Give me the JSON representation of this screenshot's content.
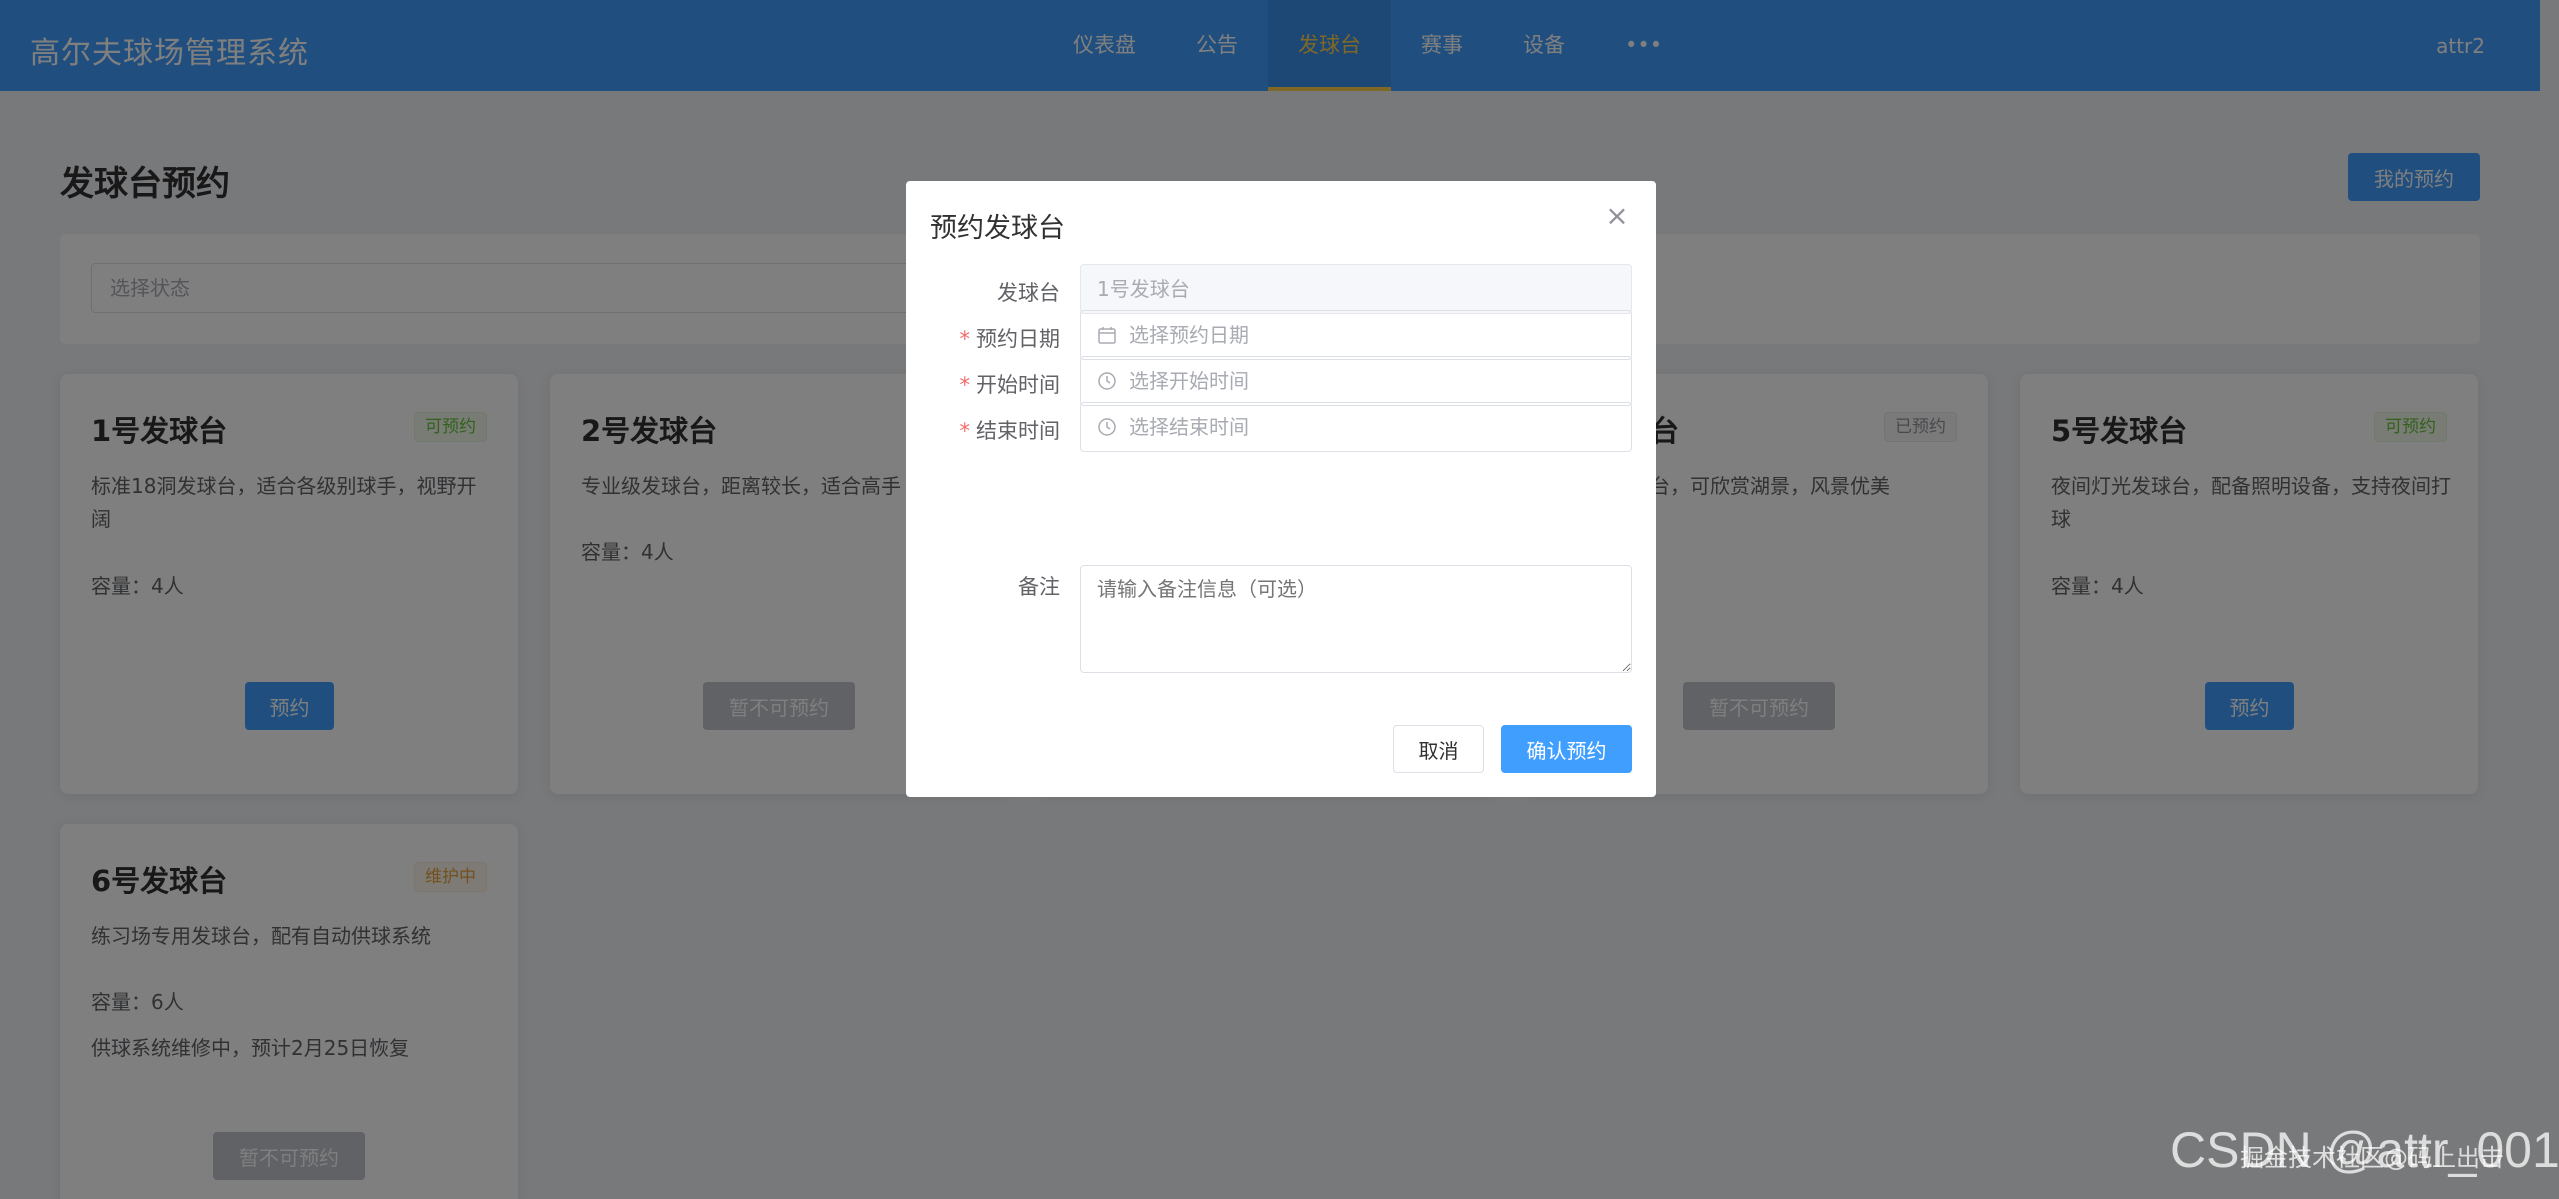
{
  "app": {
    "title": "高尔夫球场管理系统",
    "user": "attr2",
    "nav": [
      "仪表盘",
      "公告",
      "发球台",
      "赛事",
      "设备",
      "•••"
    ]
  },
  "page": {
    "title": "发球台预约",
    "my_bookings": "我的预约",
    "filter_placeholder": "选择状态"
  },
  "tees": [
    {
      "name": "1号发球台",
      "status": "可预约",
      "desc": "标准18洞发球台，适合各级别球手，视野开阔",
      "capacity": "容量：4人",
      "button": "预约"
    },
    {
      "name": "2号发球台",
      "status": "",
      "desc": "专业级发球台，距离较长，适合高手",
      "capacity": "容量：4人",
      "button": "暂不可预约"
    },
    {
      "name": "台",
      "status": "已预约",
      "desc": "台，可欣赏湖景，风景优美",
      "capacity": "",
      "button": "暂不可预约"
    },
    {
      "name": "5号发球台",
      "status": "可预约",
      "desc": "夜间灯光发球台，配备照明设备，支持夜间打球",
      "capacity": "容量：4人",
      "button": "预约"
    },
    {
      "name": "6号发球台",
      "status": "维护中",
      "desc": "练习场专用发球台，配有自动供球系统",
      "capacity": "容量：6人",
      "note": "供球系统维修中，预计2月25日恢复",
      "button": "暂不可预约"
    }
  ],
  "dialog": {
    "title": "预约发球台",
    "tee_label": "发球台",
    "tee_value": "1号发球台",
    "date_label": "预约日期",
    "date_placeholder": "选择预约日期",
    "start_label": "开始时间",
    "start_placeholder": "选择开始时间",
    "end_label": "结束时间",
    "end_placeholder": "选择结束时间",
    "remark_label": "备注",
    "remark_placeholder": "请输入备注信息（可选）",
    "cancel": "取消",
    "confirm": "确认预约",
    "required_mark": "*"
  },
  "watermark": {
    "main": "CSDN @attr_001",
    "sub": "掘金技术社区@码上出击"
  },
  "colors": {
    "primary": "#409eff",
    "nav_active": "#ffd04b",
    "success": "#67c23a",
    "warning": "#e6a23c",
    "danger": "#f56c6c"
  }
}
